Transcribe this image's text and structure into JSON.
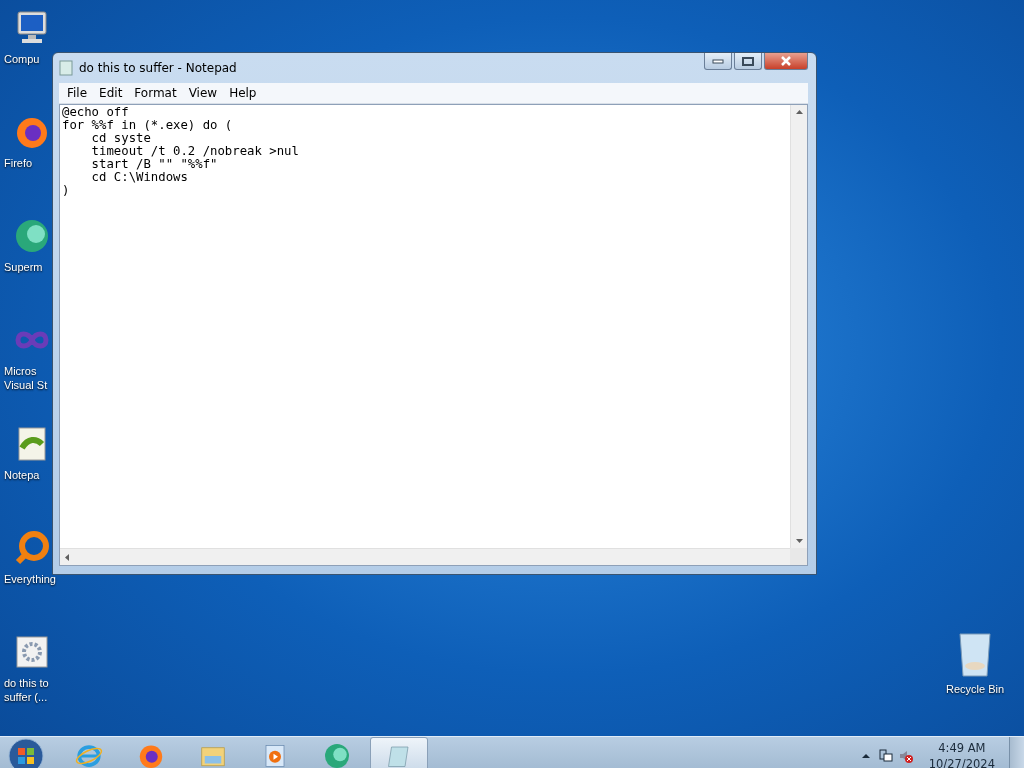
{
  "desktop_icons": [
    {
      "kind": "computer",
      "label": "Compu"
    },
    {
      "kind": "firefox",
      "label": "Firefo"
    },
    {
      "kind": "supermium",
      "label": "Superm"
    },
    {
      "kind": "visualstudio",
      "label": "Micros Visual St"
    },
    {
      "kind": "notepadpp",
      "label": "Notepa"
    },
    {
      "kind": "everything",
      "label": "Everything"
    },
    {
      "kind": "batch",
      "label": "do this to suffer (..."
    }
  ],
  "recycle_bin": {
    "label": "Recycle Bin"
  },
  "window": {
    "title": "do this to suffer - Notepad",
    "menu": [
      "File",
      "Edit",
      "Format",
      "View",
      "Help"
    ],
    "lines": [
      "@echo off",
      "for %%f in (*.exe) do (",
      "    cd syste",
      "    timeout /t 0.2 /nobreak >nul",
      "    start /B \"\" \"%%f\"",
      "    cd C:\\Windows",
      ")"
    ]
  },
  "taskbar": {
    "apps": [
      {
        "kind": "ie",
        "selected": false
      },
      {
        "kind": "firefox",
        "selected": false
      },
      {
        "kind": "explorer",
        "selected": false
      },
      {
        "kind": "media",
        "selected": false
      },
      {
        "kind": "supermium",
        "selected": false
      },
      {
        "kind": "notepad",
        "selected": true
      }
    ],
    "time": "4:49 AM",
    "date": "10/27/2024"
  }
}
